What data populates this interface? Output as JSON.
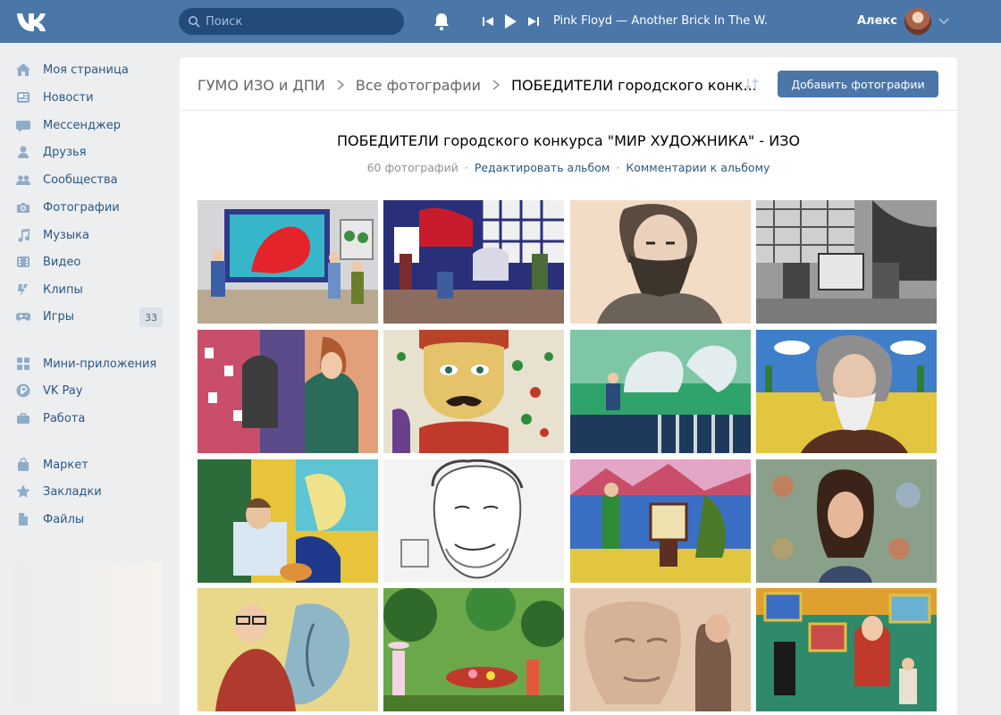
{
  "header": {
    "search_placeholder": "Поиск",
    "track": "Pink Floyd — Another Brick In The W...",
    "user_name": "Алекс"
  },
  "sidebar": {
    "items": [
      {
        "label": "Моя страница",
        "icon": "home-icon"
      },
      {
        "label": "Новости",
        "icon": "news-icon"
      },
      {
        "label": "Мессенджер",
        "icon": "messenger-icon"
      },
      {
        "label": "Друзья",
        "icon": "friends-icon"
      },
      {
        "label": "Сообщества",
        "icon": "communities-icon"
      },
      {
        "label": "Фотографии",
        "icon": "camera-icon"
      },
      {
        "label": "Музыка",
        "icon": "music-note-icon"
      },
      {
        "label": "Видео",
        "icon": "video-icon"
      },
      {
        "label": "Клипы",
        "icon": "clips-icon"
      },
      {
        "label": "Игры",
        "icon": "gamepad-icon",
        "badge": "33"
      },
      {
        "label": "Мини-приложения",
        "icon": "mini-apps-icon"
      },
      {
        "label": "VK Pay",
        "icon": "vkpay-icon"
      },
      {
        "label": "Работа",
        "icon": "briefcase-icon"
      },
      {
        "label": "Маркет",
        "icon": "market-bag-icon"
      },
      {
        "label": "Закладки",
        "icon": "star-icon"
      },
      {
        "label": "Файлы",
        "icon": "file-icon"
      }
    ]
  },
  "breadcrumb": {
    "group": "ГУМО ИЗО и ДПИ",
    "all_photos": "Все фотографии",
    "current": "ПОБЕДИТЕЛИ городского конк",
    "ellipsis": "..."
  },
  "album": {
    "add_button": "Добавить фотографии",
    "title": "ПОБЕДИТЕЛИ городского конкурса \"МИР ХУДОЖНИКА\" - ИЗО",
    "count": "60 фотографий",
    "separator": "·",
    "edit_link": "Редактировать альбом",
    "comments_link": "Комментарии к альбому"
  },
  "colors": {
    "header": "#4a76a8",
    "link": "#2a5885",
    "background": "#edeef0"
  }
}
